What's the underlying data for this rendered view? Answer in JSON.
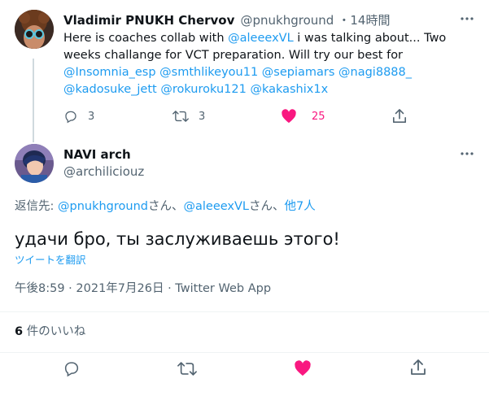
{
  "parent_tweet": {
    "display_name": "Vladimir PNUKH Chervov",
    "handle": "@pnukhground",
    "time": "・14時間",
    "text_segments": [
      {
        "t": "Here is coaches collab with ",
        "link": false
      },
      {
        "t": "@aleeexVL",
        "link": true
      },
      {
        "t": " i was talking about... Two weeks challange for VCT preparation. Will try our best for ",
        "link": false
      },
      {
        "t": "@Insomnia_esp",
        "link": true
      },
      {
        "t": " ",
        "link": false
      },
      {
        "t": "@smthlikeyou11",
        "link": true
      },
      {
        "t": " ",
        "link": false
      },
      {
        "t": "@sepiamars",
        "link": true
      },
      {
        "t": " ",
        "link": false
      },
      {
        "t": "@nagi8888_",
        "link": true
      },
      {
        "t": " ",
        "link": false
      },
      {
        "t": "@kadosuke_jett",
        "link": true
      },
      {
        "t": " ",
        "link": false
      },
      {
        "t": "@rokuroku121",
        "link": true
      },
      {
        "t": " ",
        "link": false
      },
      {
        "t": "@kakashix1x",
        "link": true
      }
    ],
    "reply_count": "3",
    "retweet_count": "3",
    "like_count": "25"
  },
  "main_tweet": {
    "display_name": "NAVI arch",
    "handle": "@archiliciouz",
    "reply_prefix": "返信先: ",
    "reply_to_1": "@pnukhground",
    "reply_sep_1": "さん、",
    "reply_to_2": "@aleeexVL",
    "reply_sep_2": "さん、",
    "reply_others": "他7人",
    "text": "удачи бро, ты заслуживаешь этого!",
    "translate": "ツイートを翻訳",
    "timestamp": "午後8:59 · 2021年7月26日 · Twitter Web App",
    "likes_count": "6",
    "likes_label": " 件のいいね"
  },
  "icons": {
    "more": "more-horizontal-icon",
    "reply": "reply-bubble-icon",
    "retweet": "retweet-arrows-icon",
    "like": "heart-icon",
    "share": "share-upload-icon"
  },
  "colors": {
    "link": "#1d9bf0",
    "like_active": "#f91880",
    "muted": "#536471"
  }
}
